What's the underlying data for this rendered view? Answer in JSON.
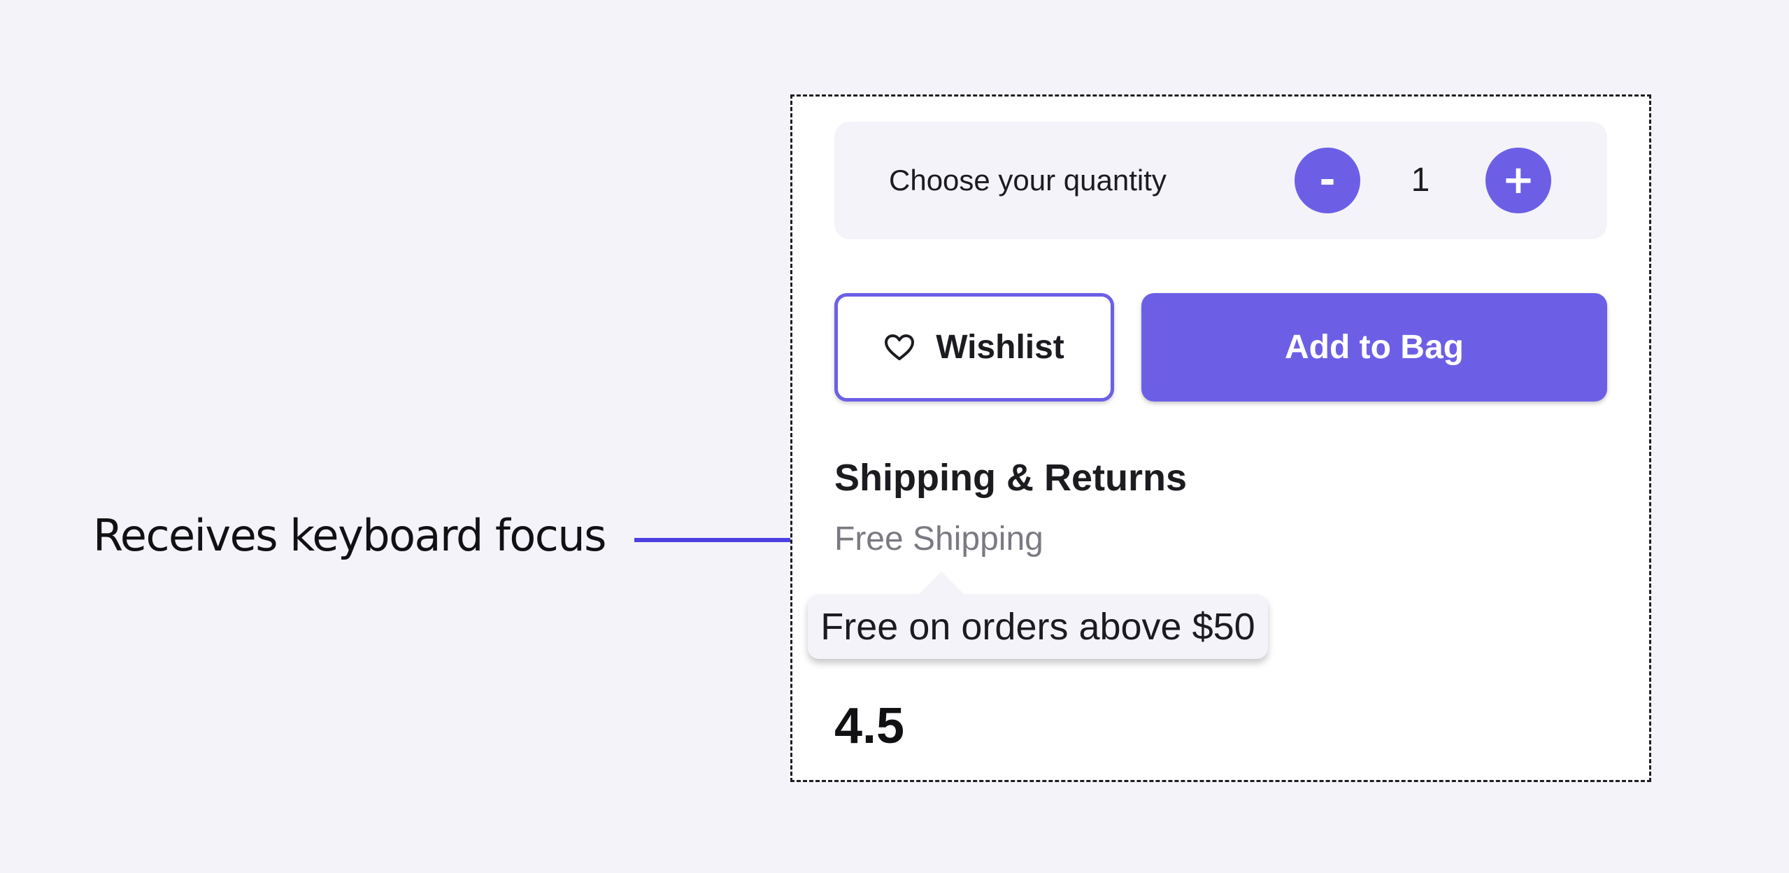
{
  "annotation": {
    "label": "Receives keyboard focus",
    "arrow_color": "#4b3fe0"
  },
  "quantity": {
    "label": "Choose your quantity",
    "decrement_label": "-",
    "value": "1",
    "increment_label": "+"
  },
  "actions": {
    "wishlist_label": "Wishlist",
    "wishlist_icon": "heart-outline-icon",
    "add_to_bag_label": "Add to Bag"
  },
  "shipping": {
    "heading": "Shipping & Returns",
    "free_shipping_label": "Free Shipping",
    "tooltip_text": "Free on orders above $50"
  },
  "rating": {
    "value": "4.5"
  },
  "colors": {
    "accent": "#6c5fe6",
    "page_background": "#f4f3f9",
    "card_background": "#ffffff",
    "muted_text": "#7a7a82"
  }
}
